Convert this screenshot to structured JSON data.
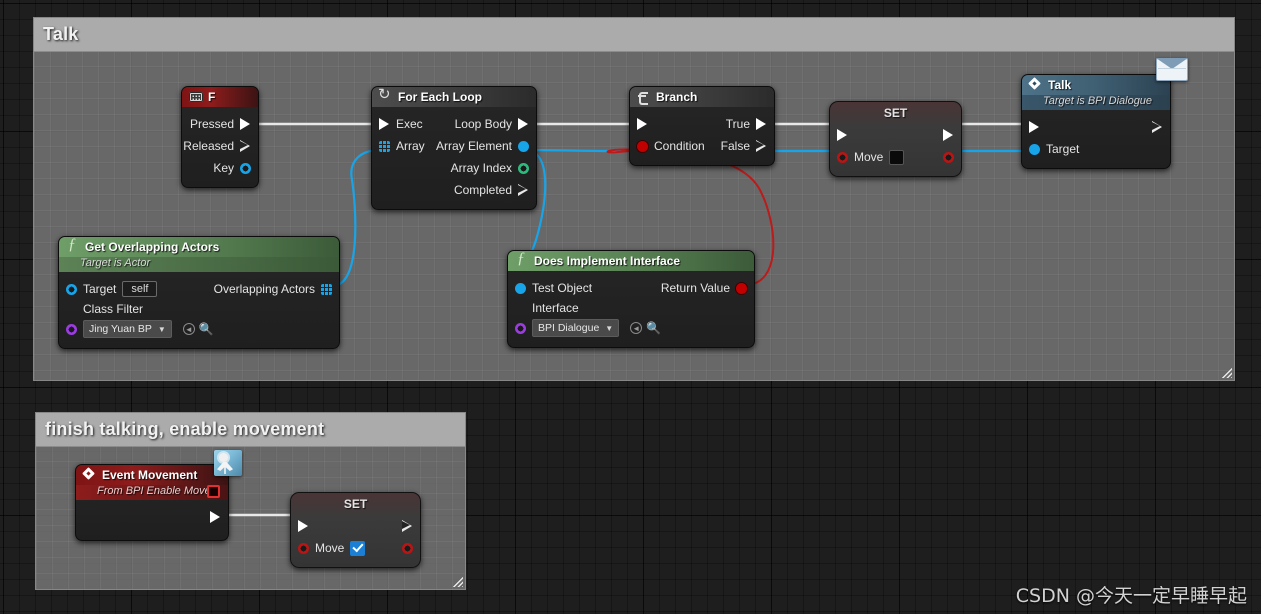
{
  "graph": {
    "watermark": "CSDN @今天一定早睡早起"
  },
  "comments": [
    {
      "id": "talk",
      "title": "Talk"
    },
    {
      "id": "movement",
      "title": "finish talking, enable movement"
    }
  ],
  "nodes": {
    "key_f": {
      "title": "F",
      "icon": "keyboard-icon",
      "pins": [
        {
          "label": "Pressed",
          "type": "exec-out",
          "style": "filled"
        },
        {
          "label": "Released",
          "type": "exec-out",
          "style": "hollow"
        },
        {
          "label": "Key",
          "type": "data-out",
          "color": "blue"
        }
      ]
    },
    "for_each_loop": {
      "title": "For Each Loop",
      "icon": "loop-icon",
      "inputs": [
        {
          "label": "Exec",
          "type": "exec-in",
          "style": "filled"
        },
        {
          "label": "Array",
          "type": "data-in",
          "color": "blue-array"
        }
      ],
      "outputs": [
        {
          "label": "Loop Body",
          "type": "exec-out",
          "style": "filled"
        },
        {
          "label": "Array Element",
          "type": "data-out",
          "color": "blue"
        },
        {
          "label": "Array Index",
          "type": "data-out",
          "color": "green"
        },
        {
          "label": "Completed",
          "type": "exec-out",
          "style": "hollow"
        }
      ]
    },
    "branch": {
      "title": "Branch",
      "icon": "branch-icon",
      "inputs": [
        {
          "label": "",
          "type": "exec-in",
          "style": "filled"
        },
        {
          "label": "Condition",
          "type": "data-in",
          "color": "red"
        }
      ],
      "outputs": [
        {
          "label": "True",
          "type": "exec-out",
          "style": "filled"
        },
        {
          "label": "False",
          "type": "exec-out",
          "style": "hollow"
        }
      ]
    },
    "set_move_top": {
      "title": "SET",
      "property_label": "Move",
      "value": false,
      "value_widget": "checkbox"
    },
    "talk": {
      "title": "Talk",
      "subtitle": "Target is BPI Dialogue",
      "icon": "interface-diamond-icon",
      "badge": "envelope-icon",
      "inputs": [
        {
          "label": "",
          "type": "exec-in",
          "style": "filled"
        },
        {
          "label": "Target",
          "type": "data-in",
          "color": "blue"
        }
      ],
      "outputs": [
        {
          "label": "",
          "type": "exec-out",
          "style": "hollow"
        }
      ]
    },
    "get_overlapping_actors": {
      "title": "Get Overlapping Actors",
      "subtitle": "Target is Actor",
      "icon": "function-icon",
      "target_label": "Target",
      "target_value": "self",
      "class_filter_label": "Class Filter",
      "class_filter_value": "Jing Yuan BP",
      "output_label": "Overlapping Actors"
    },
    "does_implement_interface": {
      "title": "Does Implement Interface",
      "icon": "function-icon",
      "test_object_label": "Test Object",
      "interface_label": "Interface",
      "interface_value": "BPI Dialogue",
      "return_value_label": "Return Value"
    },
    "event_movement": {
      "title": "Event Movement",
      "subtitle": "From BPI Enable Move",
      "icon": "event-diamond-icon",
      "badge": "blueprint-icon"
    },
    "set_move_bottom": {
      "title": "SET",
      "property_label": "Move",
      "value": true,
      "value_widget": "checkbox"
    }
  },
  "colors": {
    "exec_wire": "#e8e8e8",
    "object_wire": "#18a4e8",
    "bool_wire": "#bb1b1b",
    "canvas": "#1e1e1e",
    "comment_fill": "#7b7b7b",
    "comment_bar": "#ababab"
  }
}
